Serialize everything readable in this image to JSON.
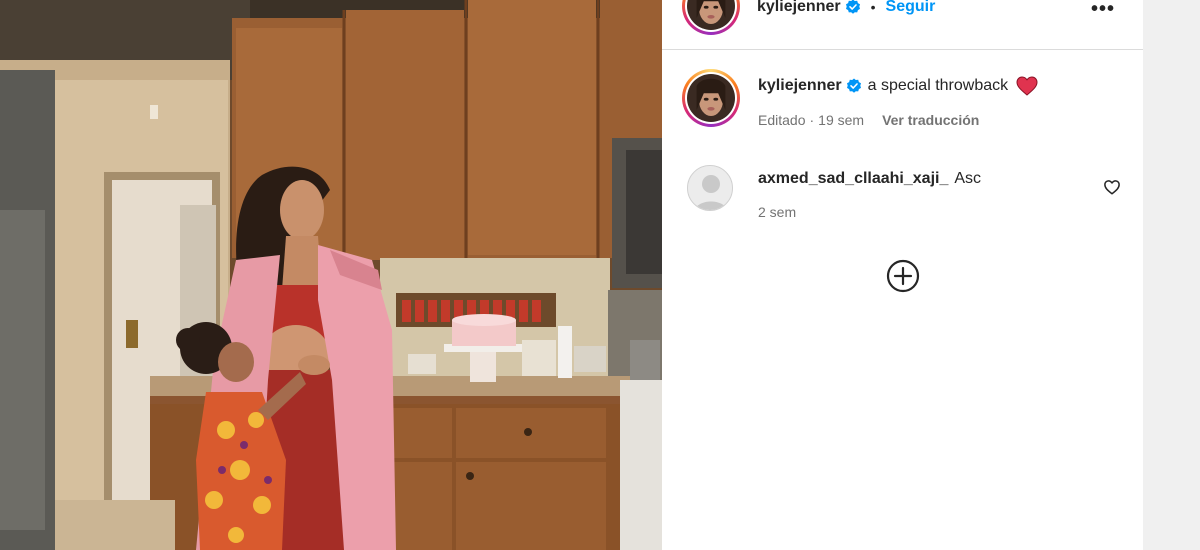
{
  "header": {
    "username": "kyliejenner",
    "separator": "•",
    "follow_label": "Seguir",
    "more_label": "•••"
  },
  "caption": {
    "username": "kyliejenner",
    "text": "a special throwback",
    "edited_label": "Editado",
    "meta_separator": "·",
    "time": "19 sem",
    "translate_label": "Ver traducción"
  },
  "comments": [
    {
      "username": "axmed_sad_cllaahi_xaji_",
      "text": "Asc",
      "time": "2 sem"
    }
  ],
  "icons": {
    "verified": "verified-badge-icon",
    "heart_emoji": "red-heart-emoji-icon",
    "like": "heart-outline-icon",
    "load_more": "plus-circle-icon",
    "more": "more-options-icon"
  },
  "colors": {
    "link_blue": "#0095f6",
    "verified_blue": "#0095f6",
    "text_primary": "#262626",
    "text_secondary": "#737373",
    "heart_red": "#e0334f"
  }
}
